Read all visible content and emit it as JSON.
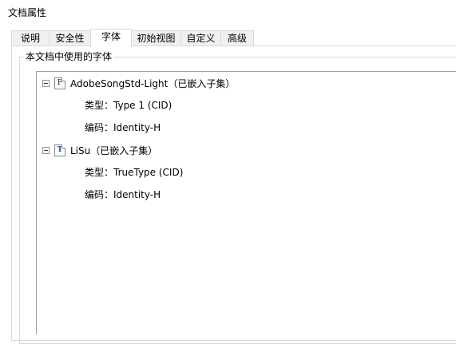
{
  "window": {
    "title": "文档属性"
  },
  "tabs": [
    {
      "label": "说明",
      "active": false
    },
    {
      "label": "安全性",
      "active": false
    },
    {
      "label": "字体",
      "active": true
    },
    {
      "label": "初始视图",
      "active": false
    },
    {
      "label": "自定义",
      "active": false
    },
    {
      "label": "高级",
      "active": false
    }
  ],
  "fonts_group": {
    "legend": "本文档中使用的字体",
    "fonts": [
      {
        "name": "AdobeSongStd-Light（已嵌入子集）",
        "icon": "type1-font-icon",
        "type_line": "类型：Type 1 (CID)",
        "encoding_line": "编码：Identity-H"
      },
      {
        "name": "LiSu（已嵌入子集）",
        "icon": "truetype-font-icon",
        "type_line": "类型：TrueType (CID)",
        "encoding_line": "编码：Identity-H"
      }
    ]
  }
}
